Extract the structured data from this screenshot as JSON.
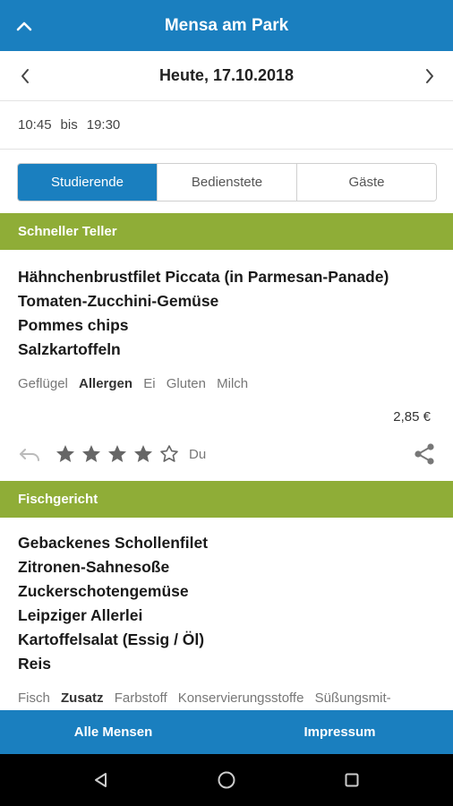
{
  "header": {
    "title": "Mensa am Park"
  },
  "date_nav": {
    "label": "Heute, 17.10.2018"
  },
  "hours": {
    "open": "10:45",
    "sep": "bis",
    "close": "19:30"
  },
  "segments": [
    {
      "label": "Studierende",
      "active": true
    },
    {
      "label": "Bedienstete",
      "active": false
    },
    {
      "label": "Gäste",
      "active": false
    }
  ],
  "sections": [
    {
      "category": "Schneller Teller",
      "dishes": [
        "Hähnchenbrustfilet Piccata (in Parmesan-Panade)",
        "Tomaten-Zucchini-Gemüse",
        "Pommes chips",
        "Salzkartoffeln"
      ],
      "tags": {
        "type": "Geflügel",
        "group": "Allergen",
        "items": [
          "Ei",
          "Gluten",
          "Milch"
        ]
      },
      "price": "2,85 €",
      "rating": {
        "stars": 4,
        "max": 5,
        "label": "Du"
      }
    },
    {
      "category": "Fischgericht",
      "dishes": [
        "Gebackenes Schollenfilet",
        "Zitronen-Sahnesoße",
        "Zuckerschotengemüse",
        "Leipziger Allerlei",
        "Kartoffelsalat (Essig / Öl)",
        "Reis"
      ],
      "tags": {
        "type": "Fisch",
        "group": "Zusatz",
        "items": [
          "Farbstoff",
          "Konservierungsstoffe",
          "Süßungsmit-"
        ]
      }
    }
  ],
  "bottom_nav": {
    "left": "Alle Mensen",
    "right": "Impressum"
  },
  "colors": {
    "primary": "#1a7fbf",
    "category": "#8fad37"
  }
}
